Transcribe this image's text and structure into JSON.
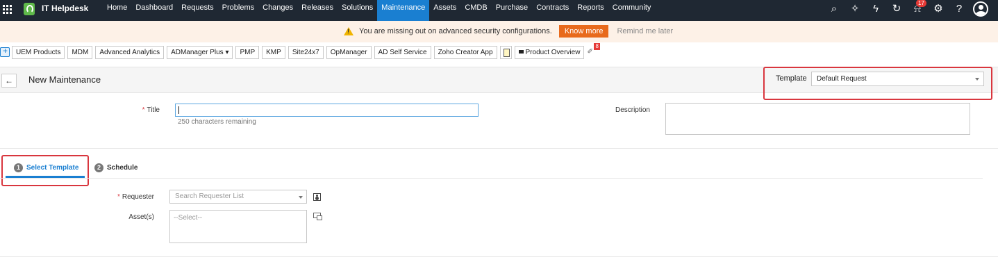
{
  "topbar": {
    "app_title": "IT Helpdesk",
    "nav": [
      "Home",
      "Dashboard",
      "Requests",
      "Problems",
      "Changes",
      "Releases",
      "Solutions",
      "Maintenance",
      "Assets",
      "CMDB",
      "Purchase",
      "Contracts",
      "Reports",
      "Community"
    ],
    "active_nav": "Maintenance",
    "notification_count": "17",
    "icons": [
      "search-icon",
      "settings-spark-icon",
      "lightning-icon",
      "history-icon",
      "bell-icon",
      "gear-icon",
      "help-icon",
      "user-avatar"
    ]
  },
  "alert": {
    "text": "You are missing out on advanced security configurations.",
    "know_more": "Know more",
    "remind": "Remind me later"
  },
  "quicklinks": {
    "items": [
      "UEM Products",
      "MDM",
      "Advanced Analytics",
      "ADManager Plus ▾",
      "PMP",
      "KMP",
      "Site24x7",
      "OpManager",
      "AD Self Service",
      "Zoho Creator App"
    ],
    "product_overview": "Product Overview",
    "pin_badge": "8"
  },
  "header": {
    "title": "New Maintenance",
    "template_label": "Template",
    "template_value": "Default Request"
  },
  "form": {
    "title_label": "Title",
    "chars_remaining": "250 characters remaining",
    "description_label": "Description"
  },
  "tabs": [
    {
      "num": "1",
      "label": "Select Template"
    },
    {
      "num": "2",
      "label": "Schedule"
    }
  ],
  "template_form": {
    "requester_label": "Requester",
    "requester_placeholder": "Search Requester List",
    "assets_label": "Asset(s)",
    "assets_placeholder": "--Select--"
  },
  "colors": {
    "topbar": "#1f2833",
    "accent": "#1a7fd1",
    "highlight": "#d9363e",
    "know_more": "#e86a1c"
  }
}
